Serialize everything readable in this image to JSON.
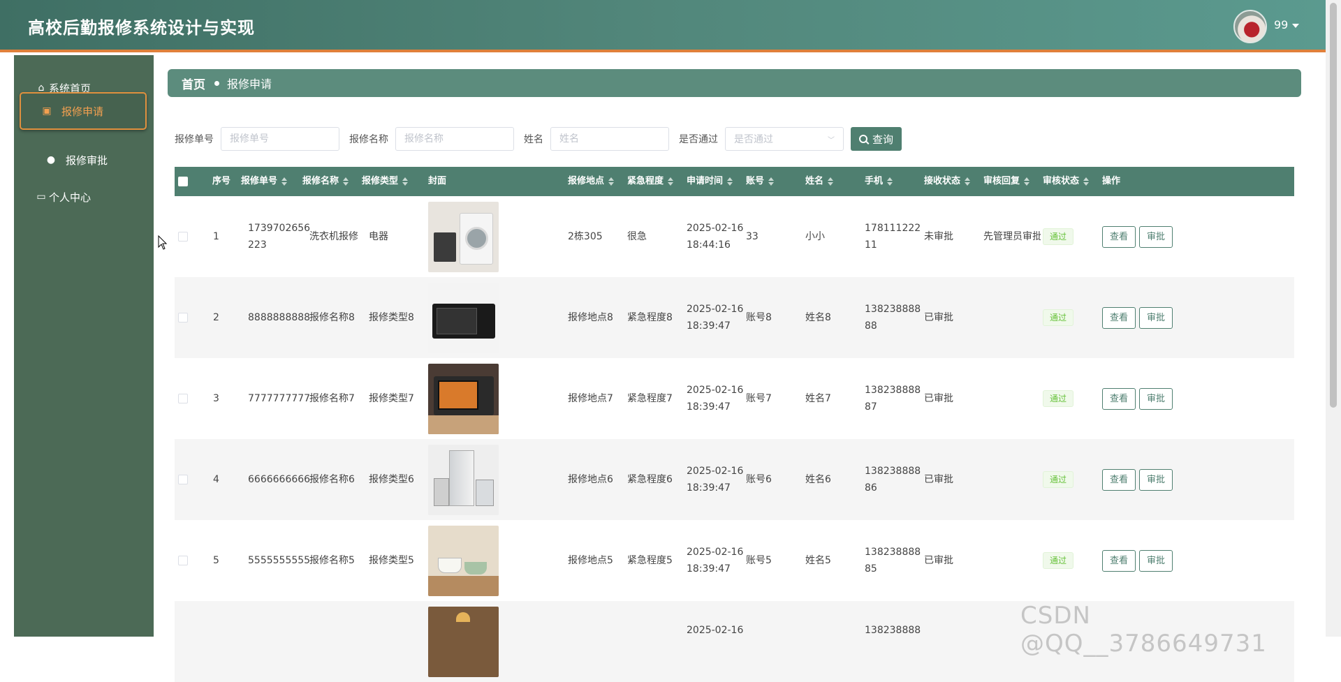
{
  "app": {
    "title": "高校后勤报修系统设计与实现",
    "username": "99"
  },
  "sidebar": {
    "items": [
      {
        "label": "系统首页",
        "icon": "home-icon"
      },
      {
        "label": "报修申请",
        "icon": "clipboard-icon"
      },
      {
        "label": "报修审批",
        "icon": "user-icon"
      },
      {
        "label": "个人中心",
        "icon": "card-icon"
      }
    ],
    "active": "报修申请"
  },
  "breadcrumb": {
    "home": "首页",
    "current": "报修申请"
  },
  "search": {
    "fields": [
      {
        "label": "报修单号",
        "placeholder": "报修单号"
      },
      {
        "label": "报修名称",
        "placeholder": "报修名称"
      },
      {
        "label": "姓名",
        "placeholder": "姓名"
      }
    ],
    "select": {
      "label": "是否通过",
      "placeholder": "是否通过"
    },
    "button": "查询"
  },
  "table": {
    "columns": [
      "序号",
      "报修单号",
      "报修名称",
      "报修类型",
      "封面",
      "报修地点",
      "紧急程度",
      "申请时间",
      "账号",
      "姓名",
      "手机",
      "接收状态",
      "审核回复",
      "审核状态",
      "操作"
    ],
    "rows": [
      {
        "no": "1",
        "order_line1": "1739702656",
        "order_line2": "223",
        "name": "洗衣机报修",
        "type": "电器",
        "cover": "washing-machine",
        "place": "2栋305",
        "urgency": "很急",
        "date": "2025-02-16",
        "time": "18:44:16",
        "account": "33",
        "person": "小小",
        "phone_line1": "178111222",
        "phone_line2": "11",
        "recv": "未审批",
        "reply": "先管理员审批",
        "status": "通过"
      },
      {
        "no": "2",
        "order_line1": "8888888888",
        "order_line2": "",
        "name": "报修名称8",
        "type": "报修类型8",
        "cover": "microwave",
        "place": "报修地点8",
        "urgency": "紧急程度8",
        "date": "2025-02-16",
        "time": "18:39:47",
        "account": "账号8",
        "person": "姓名8",
        "phone_line1": "138238888",
        "phone_line2": "88",
        "recv": "已审批",
        "reply": "",
        "status": "通过"
      },
      {
        "no": "3",
        "order_line1": "7777777777",
        "order_line2": "",
        "name": "报修名称7",
        "type": "报修类型7",
        "cover": "oven",
        "place": "报修地点7",
        "urgency": "紧急程度7",
        "date": "2025-02-16",
        "time": "18:39:47",
        "account": "账号7",
        "person": "姓名7",
        "phone_line1": "138238888",
        "phone_line2": "87",
        "recv": "已审批",
        "reply": "",
        "status": "通过"
      },
      {
        "no": "4",
        "order_line1": "6666666666",
        "order_line2": "",
        "name": "报修名称6",
        "type": "报修类型6",
        "cover": "refrigerator",
        "place": "报修地点6",
        "urgency": "紧急程度6",
        "date": "2025-02-16",
        "time": "18:39:47",
        "account": "账号6",
        "person": "姓名6",
        "phone_line1": "138238888",
        "phone_line2": "86",
        "recv": "已审批",
        "reply": "",
        "status": "通过"
      },
      {
        "no": "5",
        "order_line1": "5555555555",
        "order_line2": "",
        "name": "报修名称5",
        "type": "报修类型5",
        "cover": "kitchen-appliance",
        "place": "报修地点5",
        "urgency": "紧急程度5",
        "date": "2025-02-16",
        "time": "18:39:47",
        "account": "账号5",
        "person": "姓名5",
        "phone_line1": "138238888",
        "phone_line2": "85",
        "recv": "已审批",
        "reply": "",
        "status": "通过"
      },
      {
        "no": "",
        "order_line1": "",
        "order_line2": "",
        "name": "",
        "type": "",
        "cover": "cafe",
        "place": "",
        "urgency": "",
        "date": "2025-02-16",
        "time": "",
        "account": "",
        "person": "",
        "phone_line1": "138238888",
        "phone_line2": "",
        "recv": "",
        "reply": "",
        "status": ""
      }
    ],
    "action_view": "查看",
    "action_approve": "审批"
  },
  "watermark": "CSDN @QQ__3786649731",
  "colors": {
    "header": "#52877b",
    "accent_orange": "#e0803a",
    "sidebar": "#4c6a56",
    "table_head": "#4f7f70",
    "tag_green": "#67c23a"
  }
}
